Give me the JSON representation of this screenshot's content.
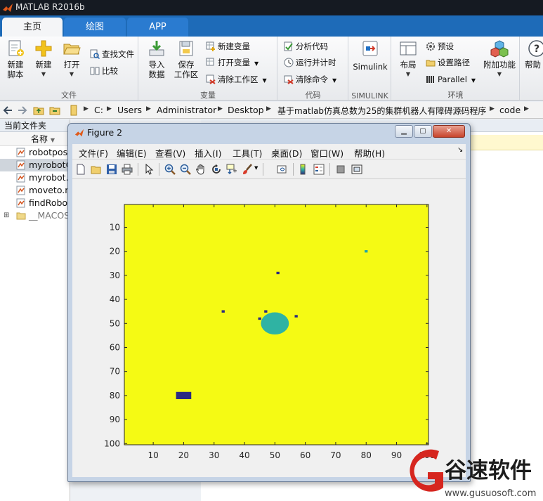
{
  "app": {
    "title": "MATLAB R2016b"
  },
  "tabs": [
    {
      "label": "主页",
      "active": true
    },
    {
      "label": "绘图",
      "active": false
    },
    {
      "label": "APP",
      "active": false
    }
  ],
  "ribbon": {
    "file": {
      "section": "文件",
      "new_script": "新建\n脚本",
      "new": "新建",
      "open": "打开",
      "find_files": "查找文件",
      "compare": "比较"
    },
    "variable": {
      "section": "变量",
      "import_data": "导入\n数据",
      "save_workspace": "保存\n工作区",
      "new_variable": "新建变量",
      "open_variable": "打开变量",
      "clear_workspace": "清除工作区"
    },
    "code": {
      "section": "代码",
      "analyze_code": "分析代码",
      "run_and_time": "运行并计时",
      "clear_commands": "清除命令"
    },
    "simulink": {
      "section": "SIMULINK",
      "simulink": "Simulink"
    },
    "environment": {
      "section": "环境",
      "layout": "布局",
      "preferences": "预设",
      "set_path": "设置路径",
      "parallel": "Parallel",
      "addons": "附加功能"
    },
    "help": {
      "label": "帮助"
    }
  },
  "address": {
    "crumbs": [
      "C:",
      "Users",
      "Administrator",
      "Desktop",
      "基于matlab仿真总数为25的集群机器人有障碍源码程序",
      "code"
    ]
  },
  "file_panel": {
    "title": "当前文件夹",
    "column": "名称",
    "files": [
      {
        "name": "robotpos",
        "type": "m"
      },
      {
        "name": "myrobotC",
        "type": "m",
        "selected": true
      },
      {
        "name": "myrobot.",
        "type": "m"
      },
      {
        "name": "moveto.m",
        "type": "m"
      },
      {
        "name": "findRobo",
        "type": "m"
      },
      {
        "name": "__MACOS",
        "type": "folder"
      }
    ]
  },
  "figure": {
    "title": "Figure 2",
    "menus": [
      "文件(F)",
      "编辑(E)",
      "查看(V)",
      "插入(I)",
      "工具(T)",
      "桌面(D)",
      "窗口(W)",
      "帮助(H)"
    ],
    "toolbar_icons": [
      "new-figure-icon",
      "open-file-icon",
      "save-icon",
      "print-icon",
      "select-arrow-icon",
      "zoom-in-icon",
      "zoom-out-icon",
      "pan-hand-icon",
      "rotate-3d-icon",
      "data-cursor-icon",
      "brush-icon",
      "link-plot-icon",
      "colorbar-icon",
      "legend-icon",
      "hide-plot-tools-icon",
      "show-plot-tools-icon"
    ]
  },
  "chart_data": {
    "type": "heatmap",
    "title": "",
    "xlabel": "",
    "ylabel": "",
    "xlim": [
      0.5,
      100.5
    ],
    "ylim": [
      0.5,
      100.5
    ],
    "y_reversed": true,
    "xticks": [
      10,
      20,
      30,
      40,
      50,
      60,
      70,
      80,
      90,
      100
    ],
    "yticks": [
      10,
      20,
      30,
      40,
      50,
      60,
      70,
      80,
      90,
      100
    ],
    "background_color": "#f5fa14",
    "colors": {
      "obstacle": "#2b2a80",
      "cluster": "#2fb3a3",
      "target": "#21a6a8"
    },
    "cells": [
      {
        "label": "target",
        "x": 80,
        "y": 20,
        "w": 1,
        "h": 1,
        "color": "target"
      },
      {
        "label": "robot",
        "x": 51,
        "y": 29,
        "w": 1,
        "h": 1,
        "color": "obstacle"
      },
      {
        "label": "robot",
        "x": 33,
        "y": 45,
        "w": 1,
        "h": 1,
        "color": "obstacle"
      },
      {
        "label": "robot",
        "x": 47,
        "y": 45,
        "w": 1,
        "h": 1,
        "color": "obstacle"
      },
      {
        "label": "robot",
        "x": 45,
        "y": 48,
        "w": 1,
        "h": 1,
        "color": "obstacle"
      },
      {
        "label": "robot",
        "x": 57,
        "y": 47,
        "w": 1,
        "h": 1,
        "color": "obstacle"
      },
      {
        "label": "obstacle",
        "x": 18,
        "y": 79,
        "w": 5,
        "h": 3,
        "color": "obstacle"
      }
    ],
    "cluster": {
      "cx": 50,
      "cy": 50,
      "rx": 4.6,
      "ry": 4.6
    }
  },
  "watermark": {
    "text": "谷速软件",
    "url": "www.gusuosoft.com"
  }
}
